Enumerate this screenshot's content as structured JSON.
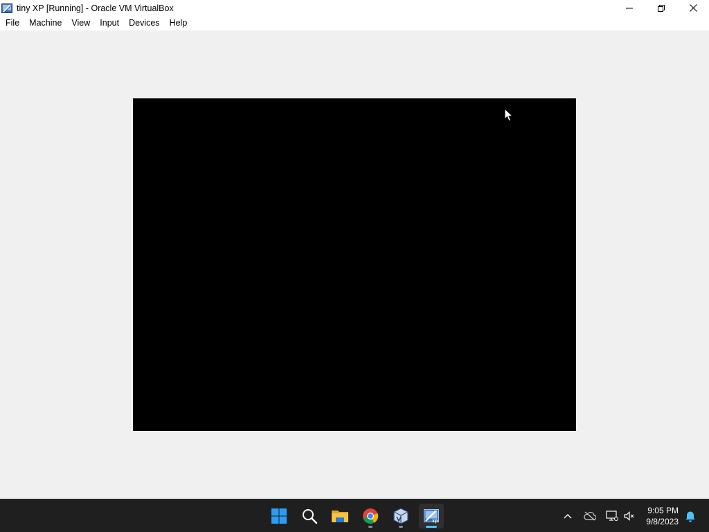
{
  "window": {
    "title": "tiny XP [Running] - Oracle VM VirtualBox",
    "icon": "virtualbox-vm-icon",
    "controls": [
      "minimize-icon",
      "restore-icon",
      "close-icon"
    ]
  },
  "menubar": {
    "items": [
      {
        "label": "File"
      },
      {
        "label": "Machine"
      },
      {
        "label": "View"
      },
      {
        "label": "Input"
      },
      {
        "label": "Devices"
      },
      {
        "label": "Help"
      }
    ]
  },
  "vm_display": {
    "background": "#000000"
  },
  "taskbar": {
    "pinned": [
      {
        "name": "start-icon"
      },
      {
        "name": "search-icon"
      },
      {
        "name": "file-explorer-icon"
      },
      {
        "name": "chrome-icon",
        "running": true
      },
      {
        "name": "virtualbox-manager-icon",
        "running": true
      },
      {
        "name": "virtualbox-vm-icon",
        "running": true,
        "active": true
      }
    ],
    "tray": [
      "chevron-up-icon",
      "onedrive-icon",
      "network-icon",
      "volume-muted-icon"
    ],
    "clock": {
      "time": "9:05 PM",
      "date": "9/8/2023"
    },
    "notification": "notification-bell-icon"
  },
  "colors": {
    "taskbar_bg": "#1f1f1f",
    "window_bg": "#f0f0f0",
    "accent": "#4cc2ff"
  }
}
